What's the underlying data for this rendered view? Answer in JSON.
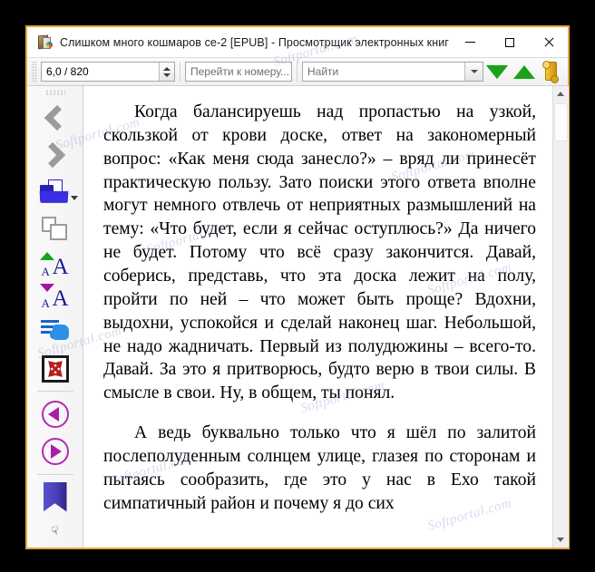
{
  "window": {
    "title": "Слишком много кошмаров се-2 [EPUB] - Просмотрщик электронных книг",
    "icon": "ebook-icon",
    "border_color": "#e8a33d",
    "controls": {
      "minimize": "minimize-icon",
      "maximize": "maximize-icon",
      "close": "close-icon"
    }
  },
  "toolbar": {
    "page_field": {
      "value": "6,0 / 820",
      "spinner_up": "spinner-up-icon",
      "spinner_down": "spinner-down-icon"
    },
    "goto_field": {
      "value": "",
      "placeholder": "Перейти к номеру..."
    },
    "find_field": {
      "value": "",
      "placeholder": "Найти",
      "dropdown": "chevron-down-icon"
    },
    "find_prev": "find-previous-icon",
    "find_next": "find-next-icon",
    "bookmark_roll": "scroll-roll-icon"
  },
  "sidebar": {
    "items": [
      {
        "name": "back-button",
        "icon": "chevron-left-icon"
      },
      {
        "name": "forward-button",
        "icon": "chevron-right-icon"
      },
      {
        "name": "open-file-button",
        "icon": "open-folder-icon"
      },
      {
        "name": "copy-pages-button",
        "icon": "copy-pages-icon"
      },
      {
        "name": "increase-font-button",
        "icon": "font-increase-icon"
      },
      {
        "name": "decrease-font-button",
        "icon": "font-decrease-icon"
      },
      {
        "name": "select-tool-button",
        "icon": "hand-select-icon"
      },
      {
        "name": "fullscreen-button",
        "icon": "fullscreen-icon"
      },
      {
        "name": "previous-page-button",
        "icon": "circle-prev-icon"
      },
      {
        "name": "next-page-button",
        "icon": "circle-next-icon"
      },
      {
        "name": "add-bookmark-button",
        "icon": "bookmark-icon"
      },
      {
        "name": "overflow-button",
        "icon": "chevron-double-down-icon"
      }
    ]
  },
  "content": {
    "paragraphs": [
      "Когда балансируешь над пропастью на узкой, скользкой от крови доске, ответ на закономерный вопрос: «Как меня сюда занесло?» – вряд ли принесёт практическую пользу. Зато поиски этого ответа вполне могут немного отвлечь от неприятных размышлений на тему: «Что будет, если я сейчас оступлюсь?» Да ничего не будет. Потому что всё сразу закончится. Давай, соберись, представь, что эта доска лежит на полу, пройти по ней – что может быть проще? Вдохни, выдохни, успокойся и сделай наконец шаг. Небольшой, не надо жадничать. Первый из полудюжины – всего-то. Давай. За это я притворюсь, будто верю в твои силы. В смысле в свои. Ну, в общем, ты понял.",
      "А ведь буквально только что я шёл по залитой послеполуденным солнцем улице, глазея по сторонам и пытаясь сообразить, где это у нас в Ехо такой симпатичный район и почему я до сих"
    ]
  },
  "scrollbar": {
    "up_arrow": "scroll-up-icon",
    "down_arrow": "scroll-down-icon",
    "thumb": "scroll-thumb"
  },
  "watermarks": [
    "Softportal.com",
    "Softportal.com",
    "Softportal.com",
    "Softportal.com",
    "Softportal.com",
    "Softportal.com",
    "Softportal.com",
    "Softportal.com",
    "Softportal.com"
  ]
}
